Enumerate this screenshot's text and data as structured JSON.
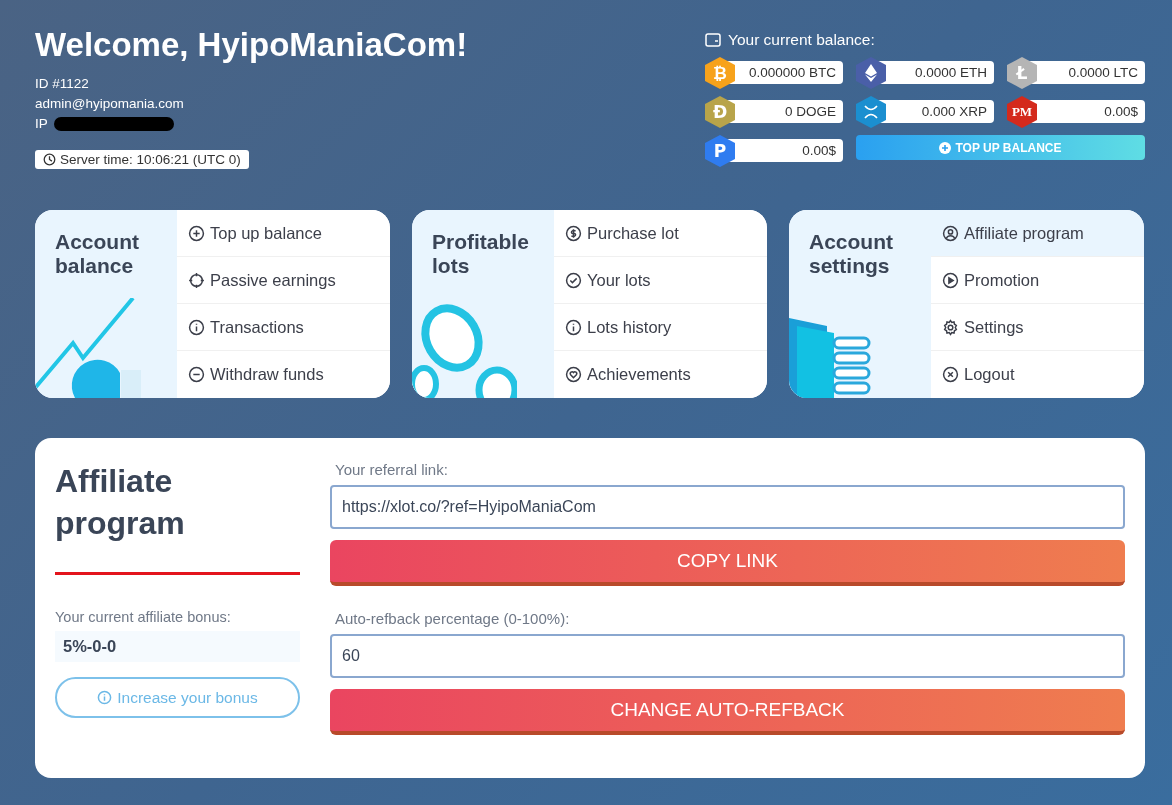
{
  "header": {
    "title": "Welcome, HyipoManiaCom!",
    "user_id": "ID #1122",
    "email": "admin@hyipomania.com",
    "ip_label": "IP",
    "server_time": "Server time: 10:06:21 (UTC 0)"
  },
  "balance": {
    "title": "Your current balance:",
    "wallets": [
      {
        "kind": "glyph",
        "symbol": "₿",
        "color": "#f7a21b",
        "amount": "0.000000 BTC"
      },
      {
        "kind": "diamond",
        "color": "#4a5fa8",
        "amount": "0.0000 ETH"
      },
      {
        "kind": "glyph",
        "symbol": "Ł",
        "color": "#b5b5b5",
        "amount": "0.0000 LTC"
      },
      {
        "kind": "glyph",
        "symbol": "Đ",
        "color": "#b8a44a",
        "amount": "0 DOGE"
      },
      {
        "kind": "cross",
        "color": "#1b8fd0",
        "amount": "0.000 XRP"
      },
      {
        "kind": "glyph",
        "symbol": "PM",
        "color": "#d42a1c",
        "amount": "0.00$"
      },
      {
        "kind": "glyph",
        "symbol": "P",
        "color": "#2f7cf0",
        "amount": "0.00$"
      }
    ],
    "top_up_button": "TOP UP BALANCE"
  },
  "cards": [
    {
      "title": "Account balance",
      "items": [
        {
          "label": "Top up balance",
          "selected": false
        },
        {
          "label": "Passive earnings",
          "selected": false
        },
        {
          "label": "Transactions",
          "selected": false
        },
        {
          "label": "Withdraw funds",
          "selected": false
        }
      ]
    },
    {
      "title": "Profitable lots",
      "items": [
        {
          "label": "Purchase lot",
          "selected": false
        },
        {
          "label": "Your lots",
          "selected": false
        },
        {
          "label": "Lots history",
          "selected": false
        },
        {
          "label": "Achievements",
          "selected": false
        }
      ]
    },
    {
      "title": "Account settings",
      "items": [
        {
          "label": "Affiliate program",
          "selected": true
        },
        {
          "label": "Promotion",
          "selected": false
        },
        {
          "label": "Settings",
          "selected": false
        },
        {
          "label": "Logout",
          "selected": false
        }
      ]
    }
  ],
  "affiliate": {
    "title": "Affiliate program",
    "bonus_label": "Your current affiliate bonus:",
    "bonus_value": "5%-0-0",
    "increase_button": "Increase your bonus",
    "link_label": "Your referral link:",
    "link_value": "https://xlot.co/?ref=HyipoManiaCom",
    "copy_button": "COPY LINK",
    "refback_label": "Auto-refback percentage (0-100%):",
    "refback_value": "60",
    "change_button": "CHANGE AUTO-REFBACK"
  }
}
